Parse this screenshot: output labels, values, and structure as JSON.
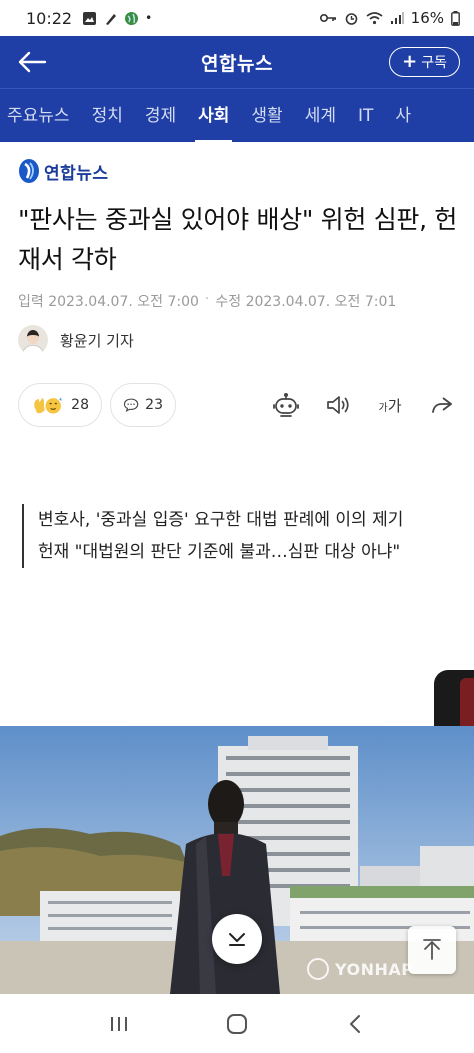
{
  "status_bar": {
    "time": "10:22",
    "battery": "16%"
  },
  "header": {
    "title": "연합뉴스",
    "subscribe_label": "구독"
  },
  "categories": [
    {
      "label": "주요뉴스",
      "active": false
    },
    {
      "label": "정치",
      "active": false
    },
    {
      "label": "경제",
      "active": false
    },
    {
      "label": "사회",
      "active": true
    },
    {
      "label": "생활",
      "active": false
    },
    {
      "label": "세계",
      "active": false
    },
    {
      "label": "IT",
      "active": false
    },
    {
      "label": "사",
      "active": false
    }
  ],
  "article": {
    "source_logo": "연합뉴스",
    "headline": "\"판사는 중과실 있어야 배상\" 위헌 심판, 헌재서 각하",
    "published": "입력 2023.04.07. 오전 7:00",
    "modified": "수정 2023.04.07. 오전 7:01",
    "reporter": "황윤기 기자",
    "reaction_count": "28",
    "comment_count": "23",
    "font_size_label_small": "가",
    "font_size_label_large": "가",
    "summary": [
      "변호사, '중과실 입증' 요구한 대법 판례에 이의 제기",
      "헌재 \"대법원의 판단 기준에 불과…심판 대상 아냐\""
    ],
    "photo_watermark": "YONHAP"
  },
  "icons": {
    "back": "back-arrow-icon",
    "plus": "plus-icon",
    "reaction": "emoji-reaction-icon",
    "comment": "comment-bubble-icon",
    "robot": "ai-robot-icon",
    "speaker": "speaker-icon",
    "share": "share-icon",
    "scroll_down": "chevron-down-icon",
    "scroll_top": "arrow-up-icon"
  },
  "colors": {
    "brand": "#1f3fa6",
    "text": "#111111",
    "meta": "#9a9a9a"
  }
}
